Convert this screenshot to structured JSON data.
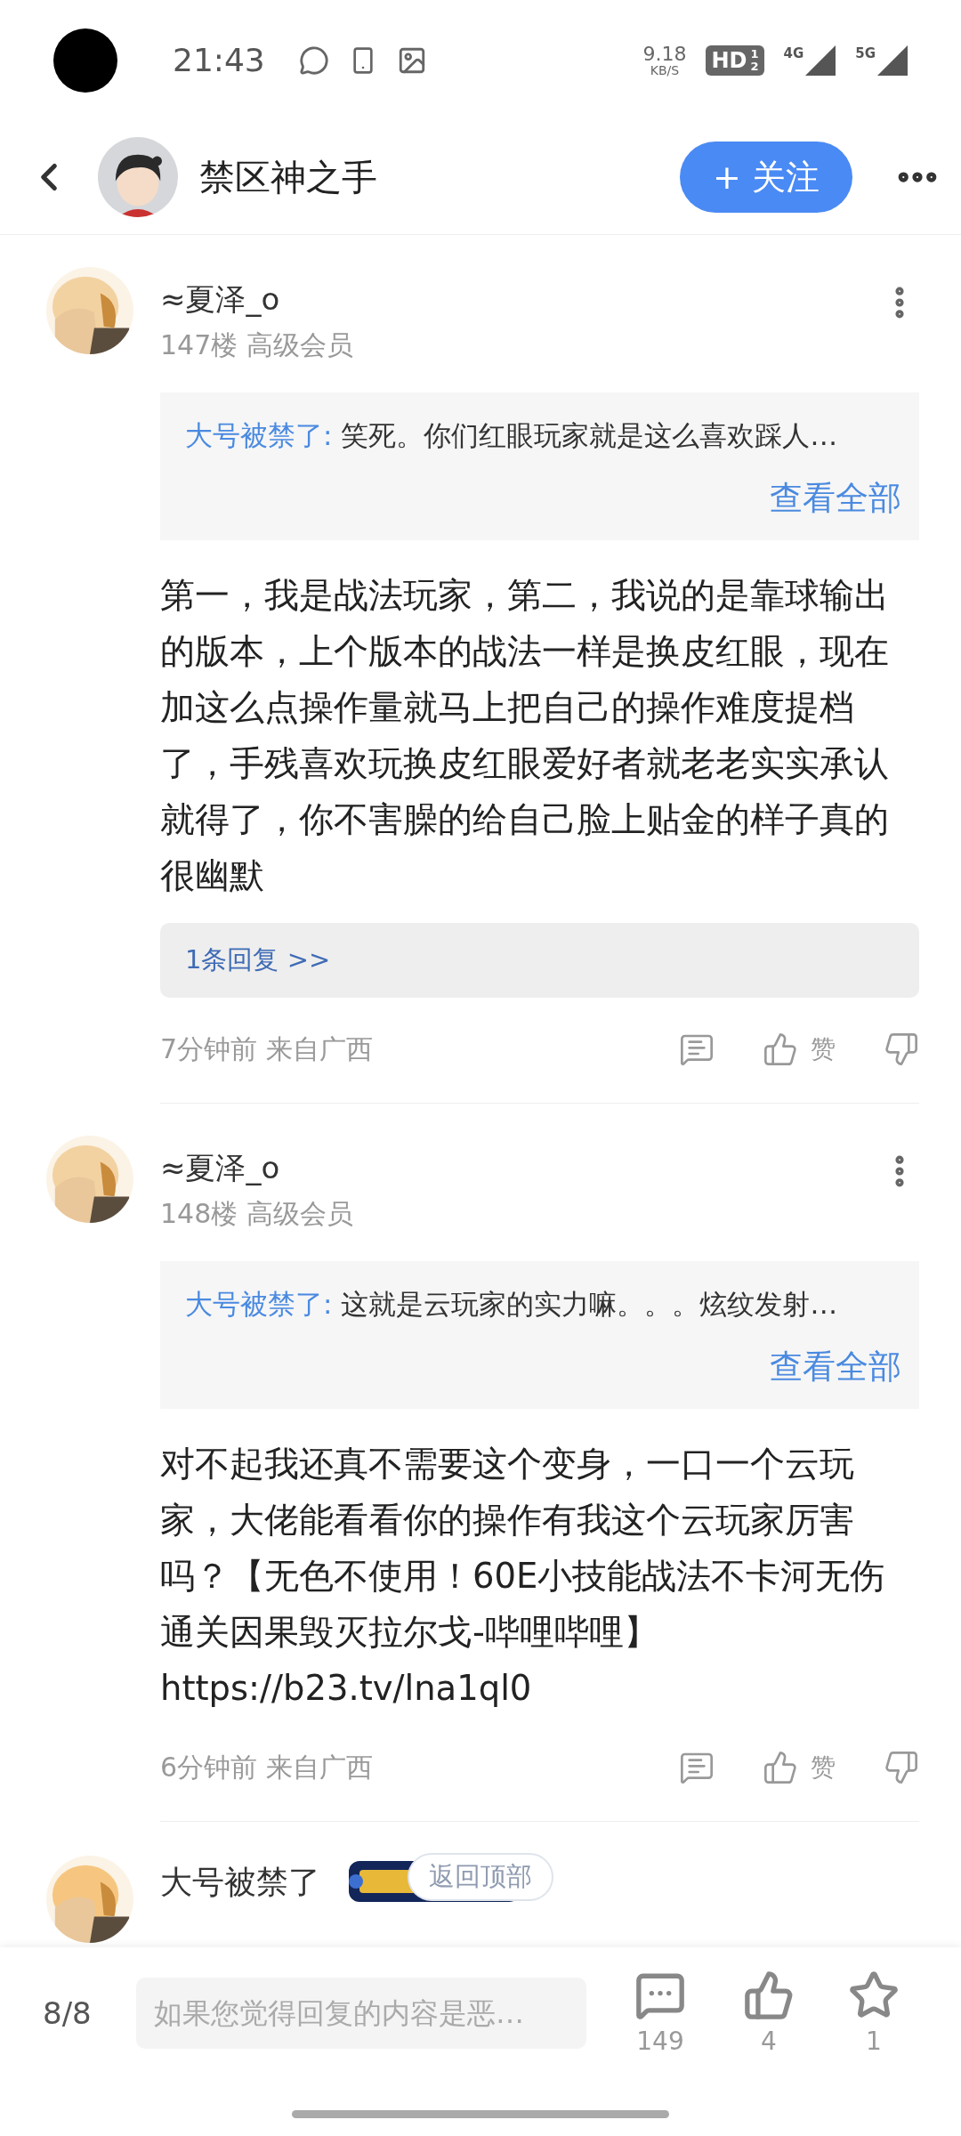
{
  "status_bar": {
    "time": "21:43",
    "net_speed": "9.18",
    "net_unit": "KB/S",
    "hd": "HD",
    "hd_slots": [
      "1",
      "2"
    ],
    "signal_1": "4G",
    "signal_2": "5G"
  },
  "header": {
    "title": "禁区神之手",
    "follow_button": "+ 关注"
  },
  "comments": [
    {
      "author": "≈夏泽_o",
      "meta": "147楼 高级会员",
      "quote": {
        "author": "大号被禁了:",
        "text": "笑死。你们红眼玩家就是这么喜欢踩人…",
        "more": "查看全部"
      },
      "body": [
        "第一，我是战法玩家，第二，我说的是靠球输出的版本，上个版本的战法一样是换皮红眼，现在加这么点操作量就马上把自己的操作难度提档了，手残喜欢玩换皮红眼爱好者就老老实实承认就得了，你不害臊的给自己脸上贴金的样子真的很幽默"
      ],
      "replies": "1条回复 >>",
      "time": "7分钟前 来自广西",
      "like_label": "赞"
    },
    {
      "author": "≈夏泽_o",
      "meta": "148楼 高级会员",
      "quote": {
        "author": "大号被禁了:",
        "text": "这就是云玩家的实力嘛。。。炫纹发射…",
        "more": "查看全部"
      },
      "body": [
        "对不起我还真不需要这个变身，一口一个云玩家，大佬能看看你的操作有我这个云玩家厉害吗？【无色不使用！60E小技能战法不卡河无伤通关因果毁灭拉尔戈-哔哩哔哩】",
        "https://b23.tv/lna1ql0"
      ],
      "time": "6分钟前 来自广西",
      "like_label": "赞"
    }
  ],
  "partial_comment": {
    "author": "大号被禁了"
  },
  "back_to_top": "返回顶部",
  "bottom_bar": {
    "page": "8/8",
    "placeholder": "如果您觉得回复的内容是恶…",
    "comments": "149",
    "likes": "4",
    "favorites": "1"
  }
}
